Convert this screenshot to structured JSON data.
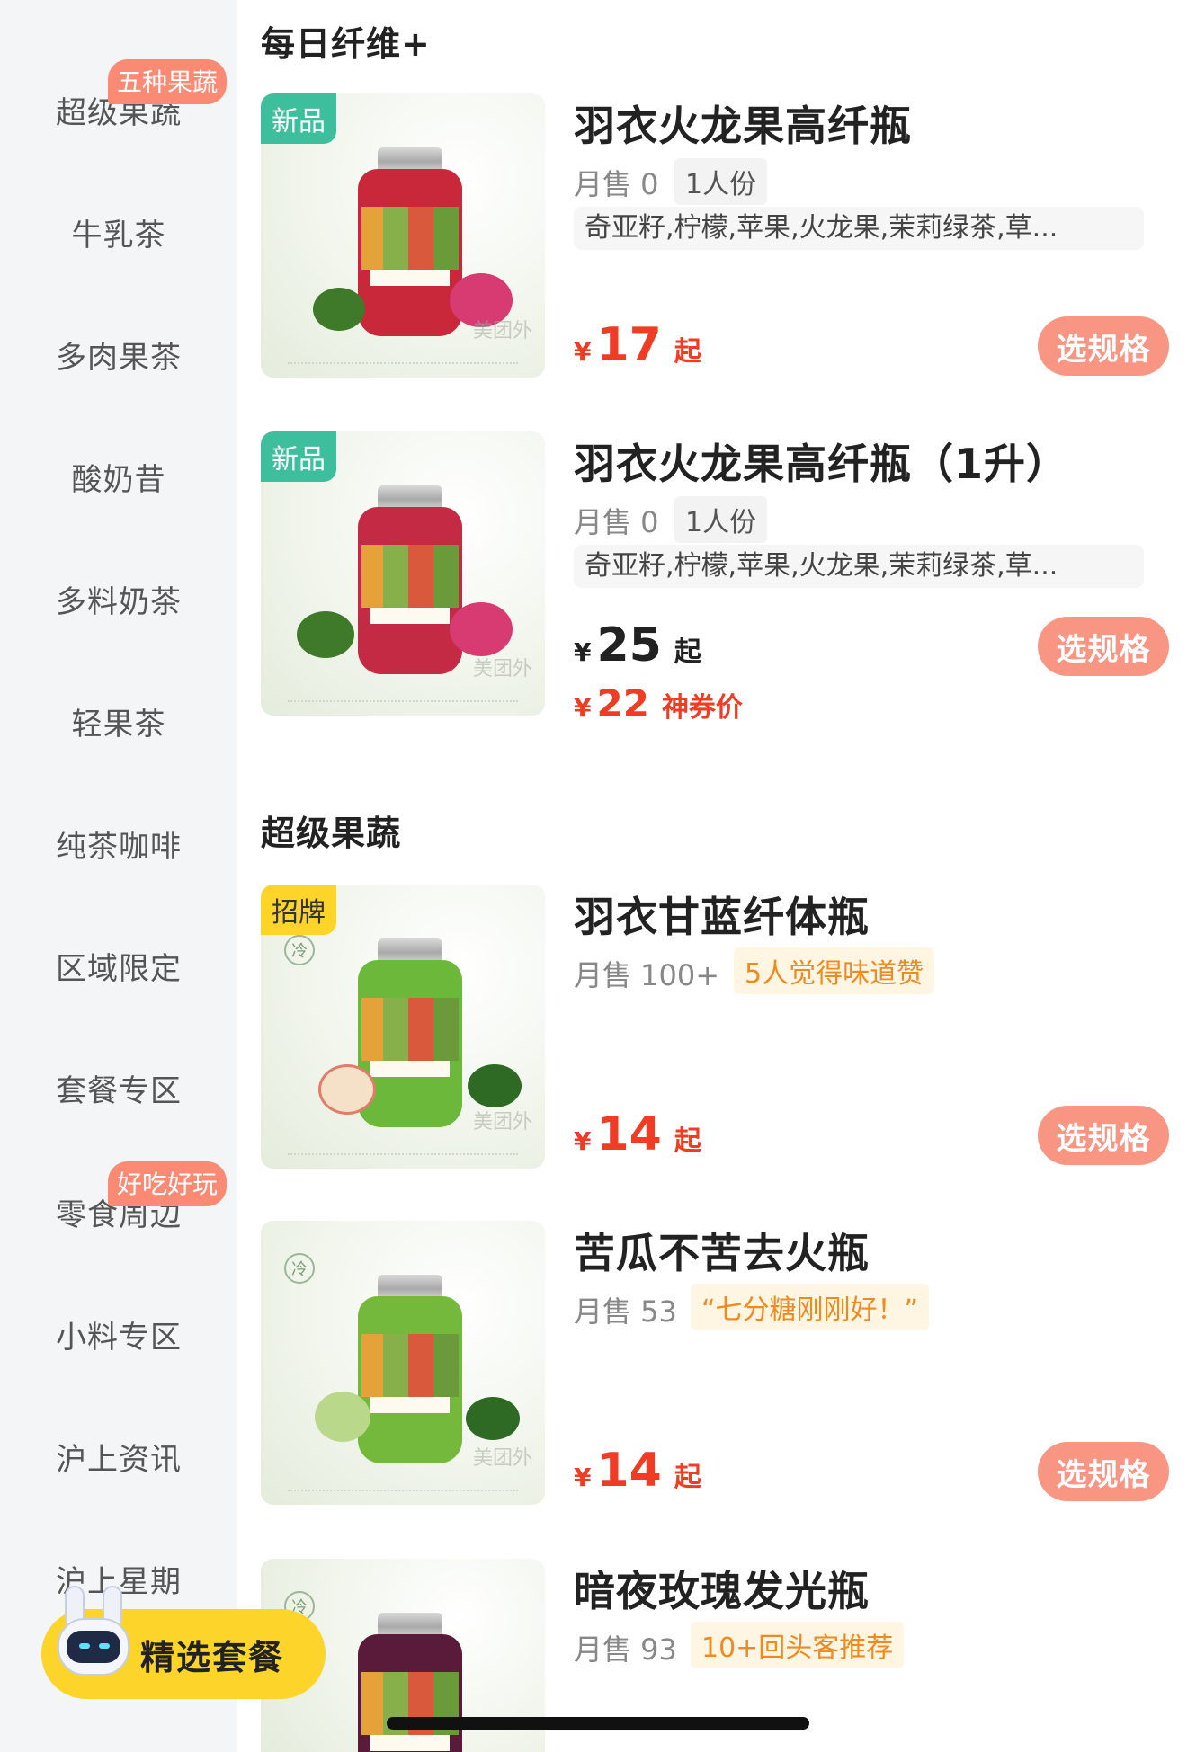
{
  "sidebar": {
    "items": [
      {
        "label": "超级果蔬",
        "badge": "五种果蔬",
        "active": true
      },
      {
        "label": "牛乳茶",
        "badge": ""
      },
      {
        "label": "多肉果茶",
        "badge": ""
      },
      {
        "label": "酸奶昔",
        "badge": ""
      },
      {
        "label": "多料奶茶",
        "badge": ""
      },
      {
        "label": "轻果茶",
        "badge": ""
      },
      {
        "label": "纯茶咖啡",
        "badge": ""
      },
      {
        "label": "区域限定",
        "badge": ""
      },
      {
        "label": "套餐专区",
        "badge": ""
      },
      {
        "label": "零食周边",
        "badge": "好吃好玩"
      },
      {
        "label": "小料专区",
        "badge": ""
      },
      {
        "label": "沪上资讯",
        "badge": ""
      },
      {
        "label": "沪上星期",
        "badge": ""
      }
    ]
  },
  "sections": [
    {
      "title": "每日纤维+"
    },
    {
      "title": "超级果蔬"
    }
  ],
  "products": [
    {
      "tag": "新品",
      "name": "羽衣火龙果高纤瓶",
      "sales": "月售 0",
      "serving": "1人份",
      "ingredients": "奇亚籽,柠檬,苹果,火龙果,茉莉绿茶,草...",
      "price_symbol": "¥",
      "price": "17",
      "price_suffix": "起",
      "button": "选规格",
      "bottle_color": "#c8283a"
    },
    {
      "tag": "新品",
      "name": "羽衣火龙果高纤瓶（1升）",
      "sales": "月售 0",
      "serving": "1人份",
      "ingredients": "奇亚籽,柠檬,苹果,火龙果,茉莉绿茶,草...",
      "price_symbol": "¥",
      "price": "25",
      "price_suffix": "起",
      "coupon_symbol": "¥",
      "coupon_price": "22",
      "coupon_label": "神券价",
      "button": "选规格",
      "bottle_color": "#c42a44"
    },
    {
      "tag": "招牌",
      "name": "羽衣甘蓝纤体瓶",
      "sales": "月售 100+",
      "highlight": "5人觉得味道赞",
      "price_symbol": "¥",
      "price": "14",
      "price_suffix": "起",
      "button": "选规格",
      "bottle_color": "#6bb83a"
    },
    {
      "tag": "",
      "name": "苦瓜不苦去火瓶",
      "sales": "月售 53",
      "highlight": "“七分糖刚刚好！”",
      "price_symbol": "¥",
      "price": "14",
      "price_suffix": "起",
      "button": "选规格",
      "bottle_color": "#74b93c"
    },
    {
      "tag": "",
      "name": "暗夜玫瑰发光瓶",
      "sales": "月售 93",
      "highlight": "10+回头客推荐",
      "bottle_color": "#5a1a3a"
    }
  ],
  "thumb_watermark": "美团外",
  "cold_icon_text": "冷",
  "combo": {
    "label": "精选套餐"
  },
  "colors": {
    "accent_red": "#f03c24",
    "button_salmon": "#f99583",
    "tag_green": "#3dbf9e",
    "tag_yellow": "#fcd42a",
    "highlight_orange": "#f08a1e"
  }
}
